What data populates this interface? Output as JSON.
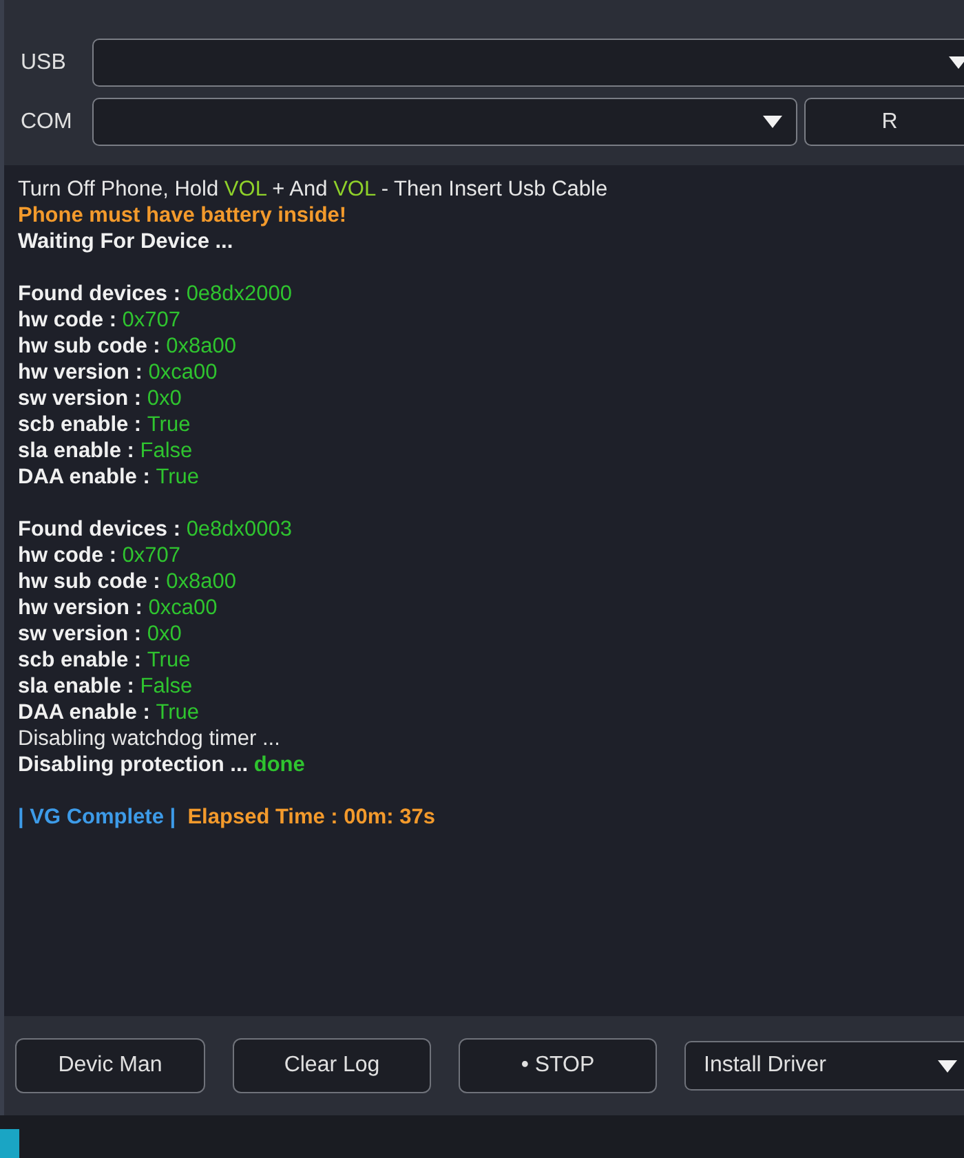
{
  "connection": {
    "usb": {
      "label": "USB"
    },
    "com": {
      "label": "COM"
    },
    "refresh_button": "R"
  },
  "log": {
    "blocks": [
      [
        {
          "parts": [
            {
              "text": "Turn Off Phone, Hold ",
              "kind": "normal"
            },
            {
              "text": "VOL",
              "kind": "lime"
            },
            {
              "text": " + And ",
              "kind": "normal"
            },
            {
              "text": "VOL",
              "kind": "lime"
            },
            {
              "text": " - Then Insert Usb Cable",
              "kind": "normal"
            }
          ]
        },
        {
          "parts": [
            {
              "text": "Phone must have battery inside!",
              "kind": "warning"
            }
          ]
        },
        {
          "parts": [
            {
              "text": "Waiting For Device ...",
              "kind": "bold"
            }
          ]
        }
      ],
      [
        {
          "parts": [
            {
              "text": "Found devices : ",
              "kind": "bold"
            },
            {
              "text": "0e8dx2000",
              "kind": "value"
            }
          ]
        },
        {
          "parts": [
            {
              "text": "hw code : ",
              "kind": "bold"
            },
            {
              "text": "0x707",
              "kind": "value"
            }
          ]
        },
        {
          "parts": [
            {
              "text": "hw sub code : ",
              "kind": "bold"
            },
            {
              "text": "0x8a00",
              "kind": "value"
            }
          ]
        },
        {
          "parts": [
            {
              "text": "hw version : ",
              "kind": "bold"
            },
            {
              "text": "0xca00",
              "kind": "value"
            }
          ]
        },
        {
          "parts": [
            {
              "text": "sw version : ",
              "kind": "bold"
            },
            {
              "text": "0x0",
              "kind": "value"
            }
          ]
        },
        {
          "parts": [
            {
              "text": "scb enable : ",
              "kind": "bold"
            },
            {
              "text": "True",
              "kind": "value"
            }
          ]
        },
        {
          "parts": [
            {
              "text": "sla enable : ",
              "kind": "bold"
            },
            {
              "text": "False",
              "kind": "value"
            }
          ]
        },
        {
          "parts": [
            {
              "text": "DAA enable : ",
              "kind": "bold"
            },
            {
              "text": "True",
              "kind": "value"
            }
          ]
        }
      ],
      [
        {
          "parts": [
            {
              "text": "Found devices : ",
              "kind": "bold"
            },
            {
              "text": "0e8dx0003",
              "kind": "value"
            }
          ]
        },
        {
          "parts": [
            {
              "text": "hw code : ",
              "kind": "bold"
            },
            {
              "text": "0x707",
              "kind": "value"
            }
          ]
        },
        {
          "parts": [
            {
              "text": "hw sub code : ",
              "kind": "bold"
            },
            {
              "text": "0x8a00",
              "kind": "value"
            }
          ]
        },
        {
          "parts": [
            {
              "text": "hw version : ",
              "kind": "bold"
            },
            {
              "text": "0xca00",
              "kind": "value"
            }
          ]
        },
        {
          "parts": [
            {
              "text": "sw version : ",
              "kind": "bold"
            },
            {
              "text": "0x0",
              "kind": "value"
            }
          ]
        },
        {
          "parts": [
            {
              "text": "scb enable : ",
              "kind": "bold"
            },
            {
              "text": "True",
              "kind": "value"
            }
          ]
        },
        {
          "parts": [
            {
              "text": "sla enable : ",
              "kind": "bold"
            },
            {
              "text": "False",
              "kind": "value"
            }
          ]
        },
        {
          "parts": [
            {
              "text": "DAA enable : ",
              "kind": "bold"
            },
            {
              "text": "True",
              "kind": "value"
            }
          ]
        },
        {
          "parts": [
            {
              "text": "Disabling watchdog timer ...",
              "kind": "normal"
            }
          ]
        },
        {
          "parts": [
            {
              "text": "Disabling protection ... ",
              "kind": "bold"
            },
            {
              "text": "done",
              "kind": "success"
            }
          ]
        }
      ],
      [
        {
          "parts": [
            {
              "text": "| VG Complete |",
              "kind": "status"
            },
            {
              "text": "  Elapsed Time : 00m: 37s",
              "kind": "warning"
            }
          ]
        }
      ]
    ]
  },
  "actions": {
    "buttons": [
      "Devic Man",
      "Clear Log",
      "• STOP"
    ],
    "driver_select": "Install Driver"
  }
}
